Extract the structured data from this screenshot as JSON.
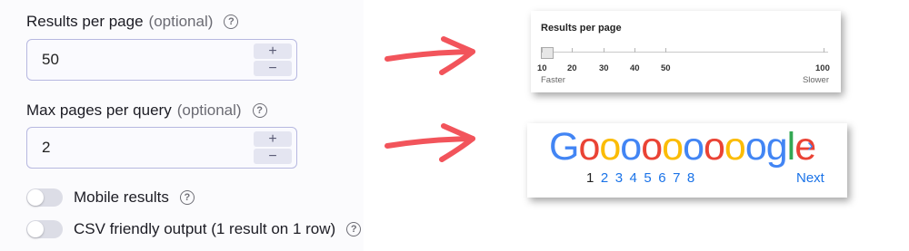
{
  "form": {
    "results_per_page": {
      "label": "Results per page",
      "optional": "(optional)",
      "value": "50",
      "plus": "+",
      "minus": "−"
    },
    "max_pages": {
      "label": "Max pages per query",
      "optional": "(optional)",
      "value": "2",
      "plus": "+",
      "minus": "−"
    },
    "mobile_results": {
      "label": "Mobile results",
      "on": false
    },
    "csv_output": {
      "label": "CSV friendly output (1 result on 1 row)",
      "on": false
    },
    "help_glyph": "?"
  },
  "slider_card": {
    "title": "Results per page",
    "ticks": [
      "10",
      "20",
      "30",
      "40",
      "50",
      "100"
    ],
    "low_label": "Faster",
    "high_label": "Slower",
    "selected": 10
  },
  "pagination_card": {
    "logo_letters": [
      "G",
      "o",
      "o",
      "o",
      "o",
      "o",
      "o",
      "o",
      "o",
      "o",
      "g",
      "l",
      "e"
    ],
    "logo_colors": [
      "#4285f4",
      "#ea4335",
      "#fbbc05",
      "#4285f4",
      "#ea4335",
      "#fbbc05",
      "#4285f4",
      "#ea4335",
      "#fbbc05",
      "#4285f4",
      "#4285f4",
      "#34a853",
      "#ea4335"
    ],
    "chevron": "›",
    "pages": [
      "1",
      "2",
      "3",
      "4",
      "5",
      "6",
      "7",
      "8"
    ],
    "current_page": "1",
    "next_label": "Next"
  },
  "colors": {
    "arrow": "#f2545b",
    "link": "#1a73e8"
  }
}
